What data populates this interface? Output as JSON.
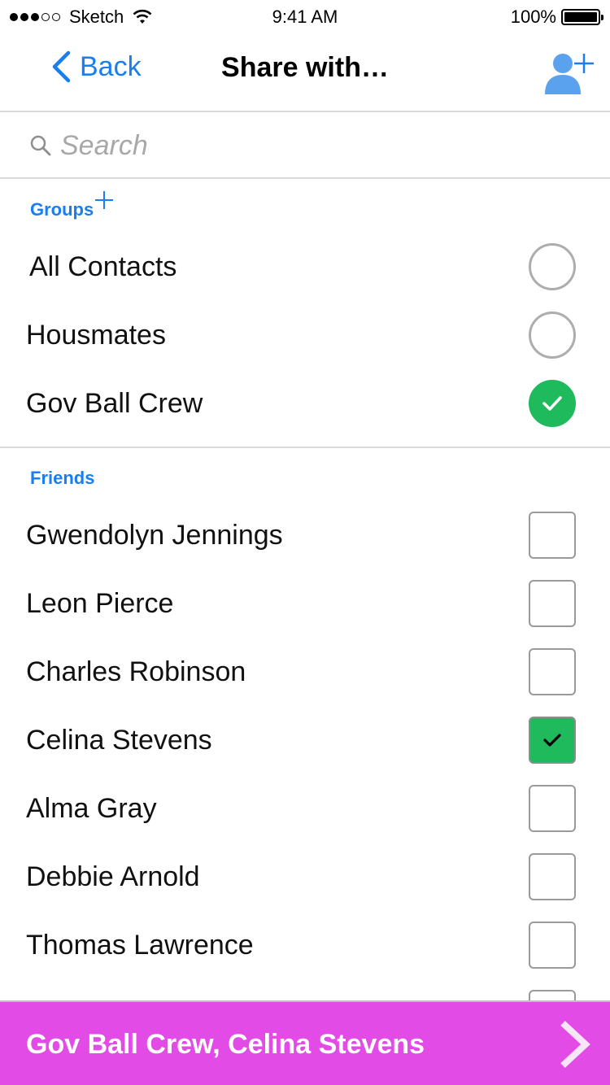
{
  "status_bar": {
    "carrier": "Sketch",
    "time": "9:41 AM",
    "battery": "100%"
  },
  "nav": {
    "back_label": "Back",
    "title": "Share with…"
  },
  "search": {
    "placeholder": "Search"
  },
  "groups": {
    "header": "Groups",
    "items": [
      {
        "label": "All Contacts",
        "checked": false
      },
      {
        "label": "Housmates",
        "checked": false
      },
      {
        "label": "Gov Ball Crew",
        "checked": true
      }
    ]
  },
  "friends": {
    "header": "Friends",
    "items": [
      {
        "label": "Gwendolyn Jennings",
        "checked": false
      },
      {
        "label": "Leon Pierce",
        "checked": false
      },
      {
        "label": "Charles Robinson",
        "checked": false
      },
      {
        "label": "Celina Stevens",
        "checked": true
      },
      {
        "label": "Alma Gray",
        "checked": false
      },
      {
        "label": "Debbie Arnold",
        "checked": false
      },
      {
        "label": "Thomas Lawrence",
        "checked": false
      }
    ]
  },
  "selection": {
    "text": "Gov Ball Crew, Celina Stevens"
  },
  "colors": {
    "accent": "#1a7ef0",
    "checked": "#1fba5c",
    "action_bar": "#e24be6"
  },
  "icons": {
    "back": "chevron-left-icon",
    "add_contact": "add-contact-icon",
    "search": "search-icon",
    "add_group": "plus-icon",
    "check": "checkmark-icon",
    "next": "chevron-right-icon"
  }
}
